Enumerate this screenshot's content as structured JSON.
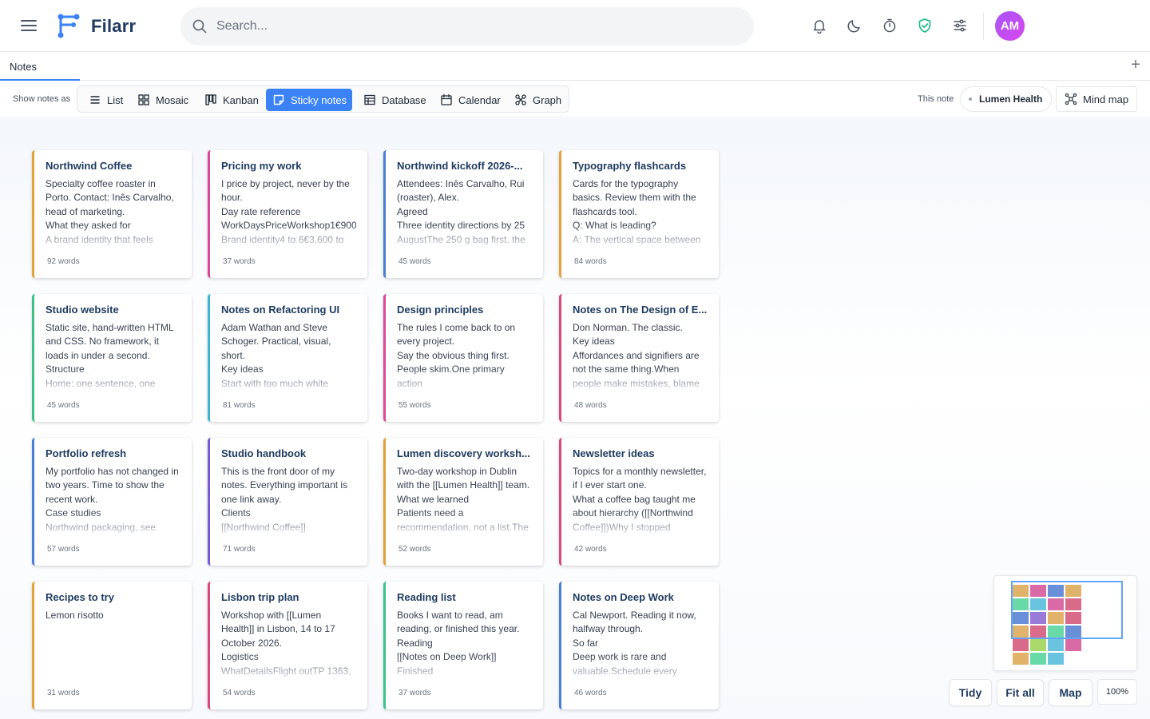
{
  "app": {
    "brand": "Filarr",
    "search_placeholder": "Search...",
    "avatar_initials": "AM"
  },
  "tabs": {
    "active_label": "Notes",
    "add_label": "+"
  },
  "view_bar": {
    "show_label": "Show notes as",
    "views": [
      {
        "label": "List",
        "icon": "list-icon"
      },
      {
        "label": "Mosaic",
        "icon": "mosaic-icon"
      },
      {
        "label": "Kanban",
        "icon": "kanban-icon"
      },
      {
        "label": "Sticky notes",
        "icon": "sticky-note-icon",
        "active": true
      },
      {
        "label": "Database",
        "icon": "table-icon"
      },
      {
        "label": "Calendar",
        "icon": "calendar-icon"
      },
      {
        "label": "Graph",
        "icon": "graph-icon"
      }
    ],
    "this_note_label": "This note",
    "current_note": "Lumen Health",
    "mind_map_label": "Mind map"
  },
  "colors": {
    "accent": "#3b82f6",
    "orange": "#e1a23a",
    "pink": "#d9489a",
    "blue": "#4a7fd6",
    "green": "#3fc08a",
    "red": "#d9487a",
    "purple": "#7a5bd6"
  },
  "notes": [
    {
      "title": "Northwind Coffee",
      "body": "Specialty coffee roaster in Porto. Contact: Inês Carvalho, head of marketing.\nWhat they asked for\nA brand identity that feels",
      "words": "92 words",
      "color": "#e1a23a"
    },
    {
      "title": "Pricing my work",
      "body": "I price by project, never by the hour.\nDay rate reference\nWorkDaysPriceWorkshop1€900\nBrand identity4 to 6€3,600 to",
      "words": "37 words",
      "color": "#d9489a"
    },
    {
      "title": "Northwind kickoff 2026-...",
      "body": "Attendees: Inês Carvalho, Rui (roaster), Alex.\nAgreed\nThree identity directions by 25\nAugustThe 250 g bag first, the",
      "words": "45 words",
      "color": "#4a7fd6"
    },
    {
      "title": "Typography flashcards",
      "body": "Cards for the typography basics. Review them with the flashcards tool.\nQ: What is leading?\nA: The vertical space between",
      "words": "84 words",
      "color": "#e1a23a"
    },
    {
      "title": "Studio website",
      "body": "Static site, hand-written HTML and CSS. No framework, it loads in under a second.\nStructure\nHome: one sentence, one",
      "words": "45 words",
      "color": "#3fc08a"
    },
    {
      "title": "Notes on Refactoring UI",
      "body": "Adam Wathan and Steve Schoger. Practical, visual, short.\nKey ideas\nStart with too much white\nspace, then remove it.Use fewer",
      "words": "81 words",
      "color": "#3fb5d6"
    },
    {
      "title": "Design principles",
      "body": "The rules I come back to on every project.\nSay the obvious thing first.\nPeople skim.One primary action\nper screen.Defaults matter",
      "words": "55 words",
      "color": "#d9489a"
    },
    {
      "title": "Notes on The Design of E...",
      "body": "Don Norman. The classic.\nKey ideas\nAffordances and signifiers are not the same thing.When\npeople make mistakes, blame",
      "words": "48 words",
      "color": "#d9487a"
    },
    {
      "title": "Portfolio refresh",
      "body": "My portfolio has not changed in two years. Time to show the recent work.\nCase studies\nNorthwind packaging, see",
      "words": "57 words",
      "color": "#4a7fd6"
    },
    {
      "title": "Studio handbook",
      "body": "This is the front door of my notes. Everything important is one link away.\nClients\n[[Northwind Coffee]]",
      "words": "71 words",
      "color": "#7a5bd6"
    },
    {
      "title": "Lumen discovery worksh...",
      "body": "Two-day workshop in Dublin with the [[Lumen Health]] team.\nWhat we learned\nPatients need a\nrecommendation, not a list.The",
      "words": "52 words",
      "color": "#e1a23a"
    },
    {
      "title": "Newsletter ideas",
      "body": "Topics for a monthly newsletter, if I ever start one.\nWhat a coffee bag taught me about hierarchy ([[Northwind\nCoffee]])Why I stopped",
      "words": "42 words",
      "color": "#d9487a"
    },
    {
      "title": "Recipes to try",
      "body": "Lemon risotto",
      "words": "31 words",
      "color": "#e1a23a"
    },
    {
      "title": "Lisbon trip plan",
      "body": "Workshop with [[Lumen Health]] in Lisbon, 14 to 17 October 2026.\nLogistics\nWhatDetailsFlight outTP 1363,",
      "words": "54 words",
      "color": "#d9487a"
    },
    {
      "title": "Reading list",
      "body": "Books I want to read, am reading, or finished this year.\nReading\n[[Notes on Deep Work]]\nFinished",
      "words": "37 words",
      "color": "#3fc08a"
    },
    {
      "title": "Notes on Deep Work",
      "body": "Cal Newport. Reading it now, halfway through.\nSo far\nDeep work is rare and\nvaluable.Schedule every minute",
      "words": "46 words",
      "color": "#4a7fd6"
    }
  ],
  "minimap": {
    "cells": [
      "#e1b36a",
      "#d96aa6",
      "#6a8fd9",
      "#e1b36a",
      "#6ad9a8",
      "#6ac4e0",
      "#d96aa6",
      "#d96a8a",
      "#6a8fd9",
      "#9a7ad9",
      "#e1b36a",
      "#d96a8a",
      "#e1b36a",
      "#d96a8a",
      "#6ad9a8",
      "#6a8fd9",
      "#d96a8a",
      "#a8d96a",
      "#6ac4e0",
      "#d96aa6",
      "#e1b36a",
      "#6ad9a8",
      "#6ac4e0"
    ]
  },
  "controls": {
    "tidy": "Tidy",
    "fit_all": "Fit all",
    "map": "Map",
    "zoom": "100%"
  }
}
